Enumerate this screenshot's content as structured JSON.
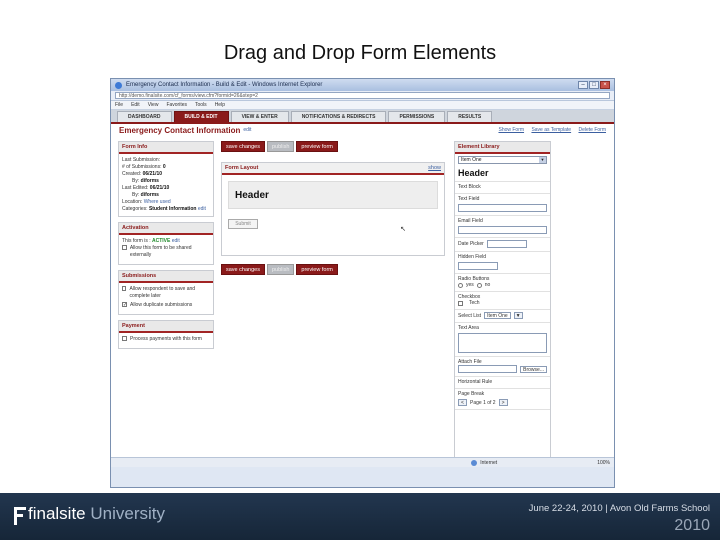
{
  "slide": {
    "title": "Drag and Drop Form Elements"
  },
  "browser": {
    "title": "Emergency Contact Information - Build & Edit - Windows Internet Explorer",
    "address": "http://demo.finalsite.com/cf_forms/view.cfm?formid=26&step=2",
    "menu": [
      "File",
      "Edit",
      "View",
      "Favorites",
      "Tools",
      "Help"
    ],
    "status_zone": "Internet",
    "zoom": "100%"
  },
  "tabs": [
    "DASHBOARD",
    "BUILD & EDIT",
    "VIEW & ENTER",
    "NOTIFICATIONS & REDIRECTS",
    "PERMISSIONS",
    "RESULTS"
  ],
  "active_tab_index": 1,
  "form": {
    "name": "Emergency Contact Information",
    "edit": "edit",
    "links": [
      "Show Form",
      "Save as Template",
      "Delete Form"
    ]
  },
  "form_info": {
    "header": "Form Info",
    "last_submission_label": "Last Submission:",
    "submissions_label": "# of Submissions:",
    "submissions_value": "0",
    "created_label": "Created:",
    "created_value": "06/21/10",
    "created_by_label": "By:",
    "created_by_value": "diforms",
    "edited_label": "Last Edited:",
    "edited_value": "06/21/10",
    "edited_by_label": "By:",
    "edited_by_value": "diforms",
    "location_label": "Location:",
    "location_value": "Where used",
    "categories_label": "Categories:",
    "categories_value": "Student Information",
    "edit": "edit"
  },
  "activation": {
    "header": "Activation",
    "status_label": "This form is :",
    "status_value": "ACTIVE",
    "edit": "edit",
    "share_label": "Allow this form to be shared externally"
  },
  "submissions": {
    "header": "Submissions",
    "opt1": "Allow respondent to save and complete later",
    "opt2": "Allow duplicate submissions",
    "opt2_checked": "✓"
  },
  "payment": {
    "header": "Payment",
    "opt1": "Process payments with this form"
  },
  "actions": {
    "save": "save changes",
    "publish": "publish",
    "preview": "preview form"
  },
  "layout": {
    "header": "Form Layout",
    "show": "show",
    "header_element": "Header",
    "submit": "Submit"
  },
  "library": {
    "header": "Element Library",
    "select_value": "Item One",
    "header_item": "Header",
    "text_block": "Text Block",
    "text_field": "Text Field",
    "email_field": "Email Field",
    "date_picker": "Date Picker",
    "hidden_field": "Hidden Field",
    "radio_label": "Radio Buttons",
    "radio_yes": "yes",
    "radio_no": "no",
    "checkbox_label": "Checkbox",
    "checkbox_option": "Tech",
    "select_list": "Select List",
    "text_area": "Text Area",
    "attach_file": "Attach File",
    "browse": "Browse...",
    "horizontal_rule": "Horizontal Rule",
    "page_break": "Page Break",
    "page_of": "Page 1 of 2",
    "prev": "<",
    "next": ">"
  },
  "footer": {
    "brand": "finalsite",
    "brand_suffix": "University",
    "event": "June 22-24, 2010 | Avon Old Farms School",
    "year": "2010"
  }
}
